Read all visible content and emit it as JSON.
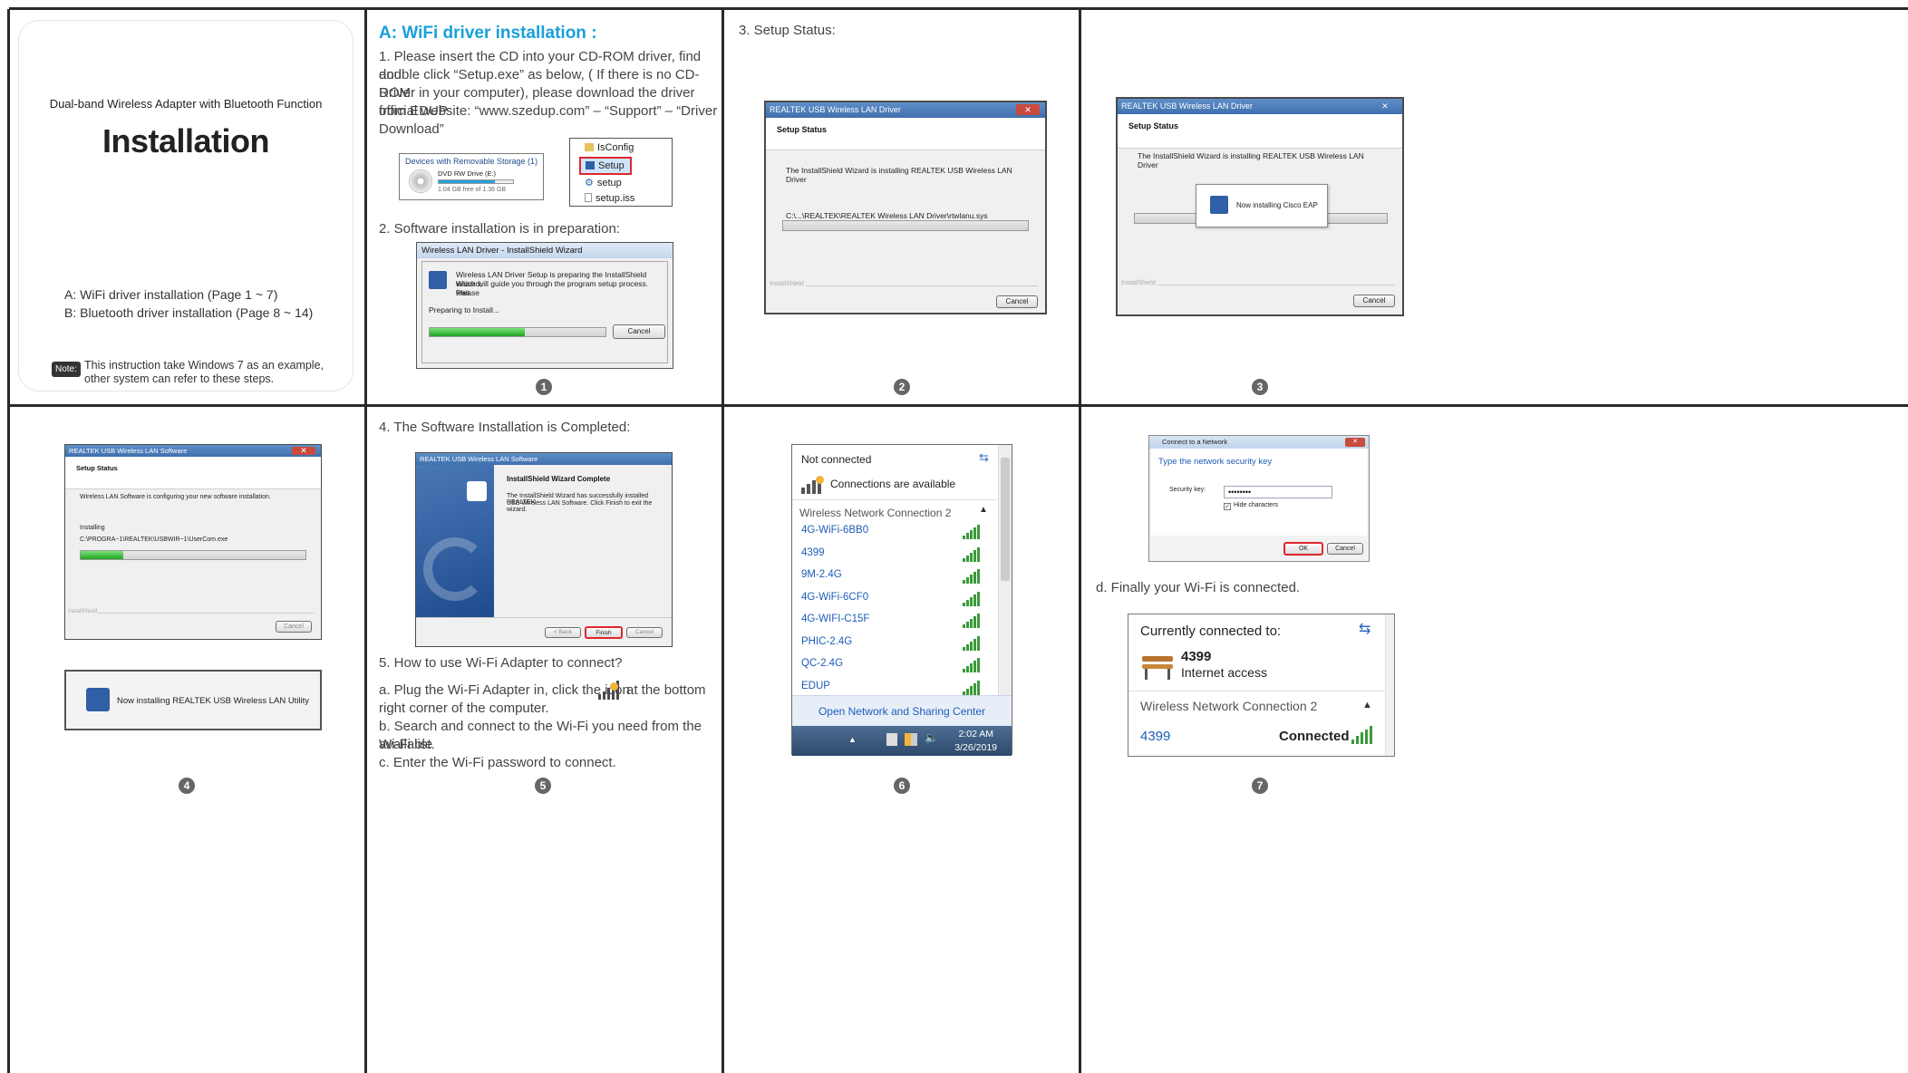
{
  "p1": {
    "subtitle": "Dual-band Wireless Adapter with Bluetooth Function",
    "title": "Installation",
    "toc_a": "A: WiFi driver installation  (Page 1 ~ 7)",
    "toc_b": "B: Bluetooth driver installation  (Page 8 ~ 14)",
    "note_badge": "Note:",
    "note_text_1": "This instruction take Windows 7 as an example,",
    "note_text_2": "other system can refer to these steps."
  },
  "p2": {
    "heading": "A: WiFi driver installation :",
    "step1_l1": "1.  Please insert the CD into your CD-ROM driver, find and",
    "step1_l2": "double click “Setup.exe” as below, ( If there is no CD-ROM",
    "step1_l3": "Driver in your computer), please download the driver from EDUP",
    "step1_l4": "official website: “www.szedup.com” – “Support” – “Driver",
    "step1_l5": "Download”",
    "drive_group": "Devices with Removable Storage (1)",
    "drive_name": "DVD RW Drive (E:)",
    "drive_free": "1.04 GB free of 1.36 GB",
    "drive_fill": 0.76,
    "files": [
      "IsConfig",
      "Setup",
      "setup",
      "setup.iss"
    ],
    "step2": "2. Software installation is in preparation:",
    "wiz_title": "Wireless LAN Driver - InstallShield Wizard",
    "wiz_msg_1": "Wireless LAN Driver Setup is preparing the InstallShield Wizard,",
    "wiz_msg_2": "which will guide you through the program setup process.  Please",
    "wiz_msg_3": "wait.",
    "wiz_preparing": "Preparing to Install...",
    "wiz_progress": 0.54,
    "wiz_cancel": "Cancel",
    "page_num": "1"
  },
  "p3": {
    "heading": "3. Setup Status:",
    "win_title": "REALTEK USB Wireless LAN Driver",
    "win_close": "✕",
    "win_header": "Setup Status",
    "win_msg": "The InstallShield Wizard is installing REALTEK USB Wireless LAN Driver",
    "win_path": "C:\\...\\REALTEK\\REALTEK Wireless LAN Driver\\rtwlanu.sys",
    "win_progress": 0.0,
    "win_footer": "InstallShield",
    "win_cancel": "Cancel",
    "page_num": "2"
  },
  "p4": {
    "win_title": "REALTEK USB Wireless LAN Driver",
    "win_close": "✕",
    "win_header": "Setup Status",
    "win_msg": "The InstallShield Wizard is installing REALTEK USB Wireless LAN Driver",
    "popup_msg": "Now installing Cisco EAP",
    "win_footer": "InstallShield",
    "win_cancel": "Cancel",
    "page_num": "3"
  },
  "p5": {
    "win_title": "REALTEK USB Wireless LAN Software",
    "win_close": "✕",
    "win_header": "Setup Status",
    "win_msg": "Wireless LAN Software is configuring your new software installation.",
    "installing": "Installing",
    "path": "C:\\PROGRA~1\\REALTEK\\USBWIR~1\\UserCom.exe",
    "progress": 0.19,
    "win_footer": "InstallShield",
    "win_cancel": "Cancel",
    "util_msg": "Now installing REALTEK USB Wireless LAN Utility",
    "page_num": "4"
  },
  "p6": {
    "heading": "4. The Software Installation is Completed:",
    "win_title": "REALTEK USB Wireless LAN Software",
    "complete_title": "InstallShield Wizard Complete",
    "complete_msg_1": "The InstallShield Wizard has successfully installed REALTEK",
    "complete_msg_2": "USB Wireless LAN Software.  Click Finish to exit the wizard.",
    "btn_back": "< Back",
    "btn_finish": "Finish",
    "btn_cancel": "Cancel",
    "step5": "5. How to use Wi-Fi Adapter to connect?",
    "step5_a1": "a. Plug the Wi-Fi Adapter in, click the icon",
    "step5_a2": "at the bottom",
    "step5_a3": "right corner of the computer.",
    "step5_b1": "b. Search and connect to the Wi-Fi you need from the available",
    "step5_b2": "Wi-Fi list.",
    "step5_c": "c. Enter the Wi-Fi password to connect.",
    "page_num": "5"
  },
  "p7": {
    "not_connected": "Not connected",
    "available": "Connections are available",
    "section": "Wireless Network Connection 2",
    "networks": [
      "4G-WiFi-6BB0",
      "4399",
      "9M-2.4G",
      "4G-WiFi-6CF0",
      "4G-WIFI-C15F",
      "PHIC-2.4G",
      "QC-2.4G",
      "EDUP"
    ],
    "open_center": "Open Network and Sharing Center",
    "tray_time": "2:02 AM",
    "tray_date": "3/26/2019",
    "page_num": "6"
  },
  "p8": {
    "dlg_title": "Connect to a Network",
    "dlg_close": "✕",
    "dlg_prompt": "Type the network security key",
    "key_label": "Security key:",
    "key_value": "••••••••",
    "hide_chars": "Hide characters",
    "btn_ok": "OK",
    "btn_cancel": "Cancel",
    "step_d": "d. Finally your Wi-Fi is connected.",
    "currently": "Currently connected to:",
    "net_name": "4399",
    "net_status": "Internet access",
    "section": "Wireless Network Connection 2",
    "conn_name": "4399",
    "conn_state": "Connected",
    "page_num": "7"
  },
  "colors": {
    "accent": "#18a0db",
    "frame": "#2a2a2a",
    "link": "#1e5db7",
    "highlight": "#e0262d"
  }
}
